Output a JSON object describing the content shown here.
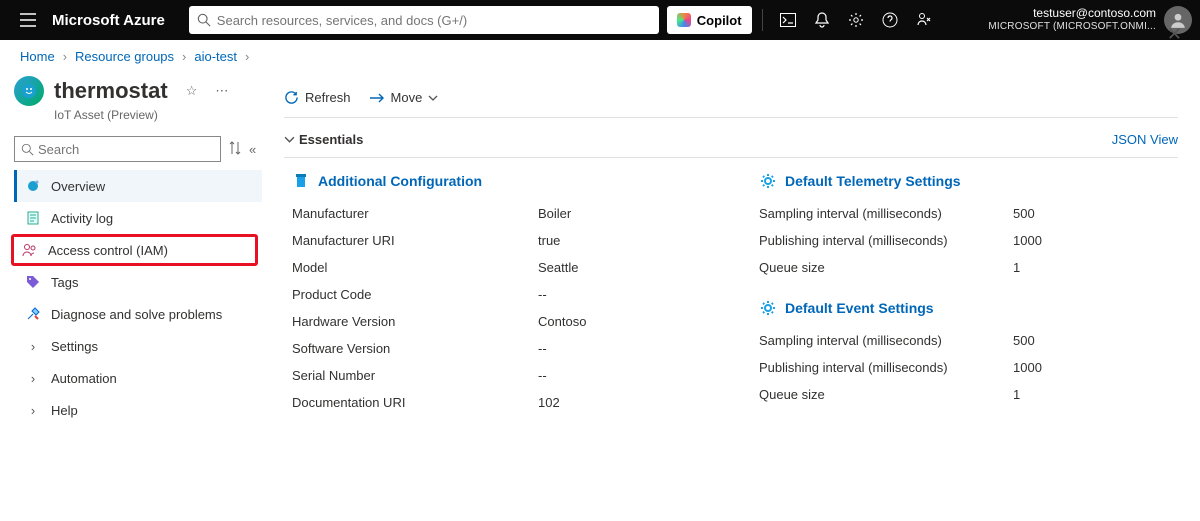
{
  "topbar": {
    "brand": "Microsoft Azure",
    "search_placeholder": "Search resources, services, and docs (G+/)",
    "copilot": "Copilot",
    "account_email": "testuser@contoso.com",
    "account_tenant": "MICROSOFT (MICROSOFT.ONMI..."
  },
  "breadcrumbs": [
    "Home",
    "Resource groups",
    "aio-test"
  ],
  "resource": {
    "title": "thermostat",
    "subtitle": "IoT Asset (Preview)"
  },
  "menu_search_placeholder": "Search",
  "menu": {
    "items": [
      {
        "label": "Overview",
        "icon": "sparkle",
        "active": true
      },
      {
        "label": "Activity log",
        "icon": "log"
      },
      {
        "label": "Access control (IAM)",
        "icon": "people",
        "highlight": true
      },
      {
        "label": "Tags",
        "icon": "tag"
      },
      {
        "label": "Diagnose and solve problems",
        "icon": "tools"
      },
      {
        "label": "Settings",
        "icon": "chev"
      },
      {
        "label": "Automation",
        "icon": "chev"
      },
      {
        "label": "Help",
        "icon": "chev"
      }
    ]
  },
  "toolbar": {
    "refresh": "Refresh",
    "move": "Move"
  },
  "essentials": {
    "label": "Essentials",
    "json_view": "JSON View",
    "sections": [
      {
        "title": "Additional Configuration",
        "rows": [
          {
            "k": "Manufacturer",
            "v": "Boiler"
          },
          {
            "k": "Manufacturer URI",
            "v": "true"
          },
          {
            "k": "Model",
            "v": "Seattle"
          },
          {
            "k": "Product Code",
            "v": "--"
          },
          {
            "k": "Hardware Version",
            "v": "Contoso"
          },
          {
            "k": "Software Version",
            "v": "--"
          },
          {
            "k": "Serial Number",
            "v": "--"
          },
          {
            "k": "Documentation URI",
            "v": "102"
          }
        ]
      },
      {
        "title": "Default Telemetry Settings",
        "rows": [
          {
            "k": "Sampling interval (milliseconds)",
            "v": "500"
          },
          {
            "k": "Publishing interval (milliseconds)",
            "v": "1000"
          },
          {
            "k": "Queue size",
            "v": "1"
          }
        ]
      },
      {
        "title": "Default Event Settings",
        "rows": [
          {
            "k": "Sampling interval (milliseconds)",
            "v": "500"
          },
          {
            "k": "Publishing interval (milliseconds)",
            "v": "1000"
          },
          {
            "k": "Queue size",
            "v": "1"
          }
        ]
      }
    ]
  }
}
